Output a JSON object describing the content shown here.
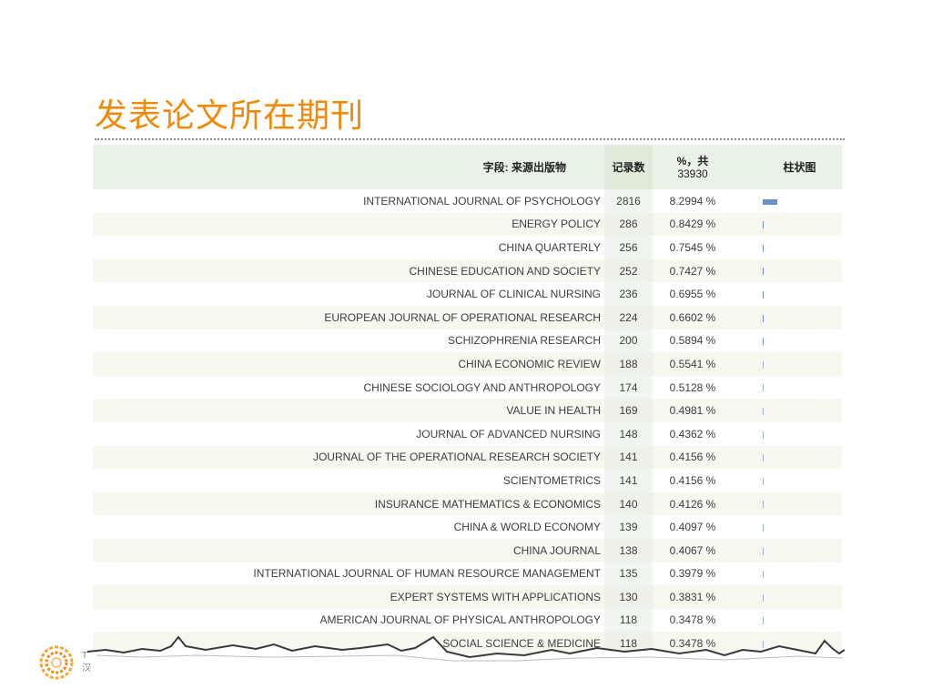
{
  "slide": {
    "title": "发表论文所在期刊",
    "logo_text": [
      "T",
      "汉"
    ]
  },
  "table": {
    "headers": {
      "source": "字段: 来源出版物",
      "count": "记录数",
      "percent_top": "%，共",
      "percent_total": "33930",
      "bar": "柱状图"
    },
    "rows": [
      {
        "source": "INTERNATIONAL JOURNAL OF PSYCHOLOGY",
        "count": "2816",
        "percent": "8.2994 %",
        "share": 0.082994
      },
      {
        "source": "ENERGY POLICY",
        "count": "286",
        "percent": "0.8429 %",
        "share": 0.008429
      },
      {
        "source": "CHINA QUARTERLY",
        "count": "256",
        "percent": "0.7545 %",
        "share": 0.007545
      },
      {
        "source": "CHINESE EDUCATION AND SOCIETY",
        "count": "252",
        "percent": "0.7427 %",
        "share": 0.007427
      },
      {
        "source": "JOURNAL OF CLINICAL NURSING",
        "count": "236",
        "percent": "0.6955 %",
        "share": 0.006955
      },
      {
        "source": "EUROPEAN JOURNAL OF OPERATIONAL RESEARCH",
        "count": "224",
        "percent": "0.6602 %",
        "share": 0.006602
      },
      {
        "source": "SCHIZOPHRENIA RESEARCH",
        "count": "200",
        "percent": "0.5894 %",
        "share": 0.005894
      },
      {
        "source": "CHINA ECONOMIC REVIEW",
        "count": "188",
        "percent": "0.5541 %",
        "share": 0.005541
      },
      {
        "source": "CHINESE SOCIOLOGY AND ANTHROPOLOGY",
        "count": "174",
        "percent": "0.5128 %",
        "share": 0.005128
      },
      {
        "source": "VALUE IN HEALTH",
        "count": "169",
        "percent": "0.4981 %",
        "share": 0.004981
      },
      {
        "source": "JOURNAL OF ADVANCED NURSING",
        "count": "148",
        "percent": "0.4362 %",
        "share": 0.004362
      },
      {
        "source": "JOURNAL OF THE OPERATIONAL RESEARCH SOCIETY",
        "count": "141",
        "percent": "0.4156 %",
        "share": 0.004156
      },
      {
        "source": "SCIENTOMETRICS",
        "count": "141",
        "percent": "0.4156 %",
        "share": 0.004156
      },
      {
        "source": "INSURANCE MATHEMATICS & ECONOMICS",
        "count": "140",
        "percent": "0.4126 %",
        "share": 0.004126
      },
      {
        "source": "CHINA & WORLD ECONOMY",
        "count": "139",
        "percent": "0.4097 %",
        "share": 0.004097
      },
      {
        "source": "CHINA JOURNAL",
        "count": "138",
        "percent": "0.4067 %",
        "share": 0.004067
      },
      {
        "source": "INTERNATIONAL JOURNAL OF HUMAN RESOURCE MANAGEMENT",
        "count": "135",
        "percent": "0.3979 %",
        "share": 0.003979
      },
      {
        "source": "EXPERT SYSTEMS WITH APPLICATIONS",
        "count": "130",
        "percent": "0.3831 %",
        "share": 0.003831
      },
      {
        "source": "AMERICAN JOURNAL OF PHYSICAL ANTHROPOLOGY",
        "count": "118",
        "percent": "0.3478 %",
        "share": 0.003478
      },
      {
        "source": "SOCIAL SCIENCE & MEDICINE",
        "count": "118",
        "percent": "0.3478 %",
        "share": 0.003478
      }
    ]
  },
  "colors": {
    "title": "#f08a0a",
    "header_bg": "#e9f2e6",
    "bar": "#6b8fc9",
    "row_alt": "#f7f7ef"
  }
}
